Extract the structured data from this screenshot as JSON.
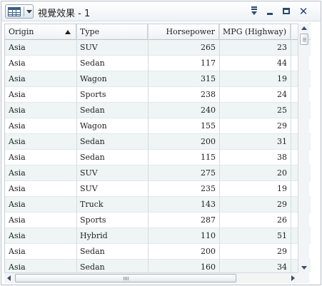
{
  "window": {
    "title": "視覺效果 - 1",
    "view_button_icon": "table-icon",
    "controls": {
      "menu_icon": "panel-menu-icon",
      "minimize_icon": "minimize-icon",
      "maximize_icon": "maximize-icon",
      "close_glyph": "✕"
    }
  },
  "table": {
    "sort": {
      "column": "Origin",
      "direction": "ascending"
    },
    "columns": [
      {
        "label": "Origin"
      },
      {
        "label": "Type"
      },
      {
        "label": "Horsepower"
      },
      {
        "label": "MPG (Highway)"
      }
    ],
    "rows": [
      {
        "origin": "Asia",
        "type": "SUV",
        "horsepower": "265",
        "mpg": "23"
      },
      {
        "origin": "Asia",
        "type": "Sedan",
        "horsepower": "117",
        "mpg": "44"
      },
      {
        "origin": "Asia",
        "type": "Wagon",
        "horsepower": "315",
        "mpg": "19"
      },
      {
        "origin": "Asia",
        "type": "Sports",
        "horsepower": "238",
        "mpg": "24"
      },
      {
        "origin": "Asia",
        "type": "Sedan",
        "horsepower": "240",
        "mpg": "25"
      },
      {
        "origin": "Asia",
        "type": "Wagon",
        "horsepower": "155",
        "mpg": "29"
      },
      {
        "origin": "Asia",
        "type": "Sedan",
        "horsepower": "200",
        "mpg": "31"
      },
      {
        "origin": "Asia",
        "type": "Sedan",
        "horsepower": "115",
        "mpg": "38"
      },
      {
        "origin": "Asia",
        "type": "SUV",
        "horsepower": "275",
        "mpg": "20"
      },
      {
        "origin": "Asia",
        "type": "SUV",
        "horsepower": "235",
        "mpg": "19"
      },
      {
        "origin": "Asia",
        "type": "Truck",
        "horsepower": "143",
        "mpg": "29"
      },
      {
        "origin": "Asia",
        "type": "Sports",
        "horsepower": "287",
        "mpg": "26"
      },
      {
        "origin": "Asia",
        "type": "Hybrid",
        "horsepower": "110",
        "mpg": "51"
      },
      {
        "origin": "Asia",
        "type": "Sedan",
        "horsepower": "200",
        "mpg": "29"
      },
      {
        "origin": "Asia",
        "type": "Sedan",
        "horsepower": "160",
        "mpg": "34"
      }
    ]
  },
  "colors": {
    "alt_row": "#eef5f4",
    "accent": "#274a73"
  }
}
